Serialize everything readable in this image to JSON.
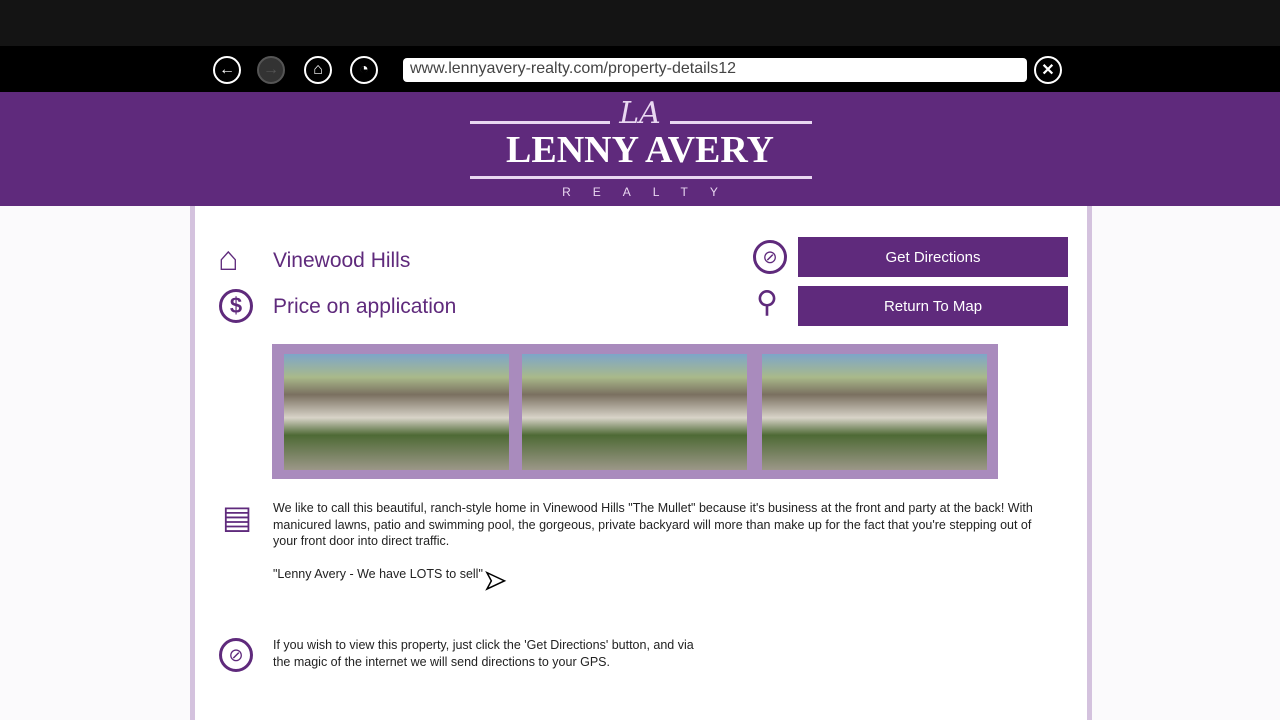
{
  "browser": {
    "url": "www.lennyavery-realty.com/property-details12",
    "icons": [
      "back-icon",
      "forward-icon",
      "home-icon",
      "history-icon",
      "close-icon"
    ]
  },
  "logo": {
    "monogram": "LA",
    "name": "LENNY AVERY",
    "sub": "REALTY"
  },
  "property": {
    "location": "Vinewood Hills",
    "price": "Price on application"
  },
  "buttons": {
    "directions": "Get Directions",
    "return": "Return To Map"
  },
  "description": {
    "body": "We like to call this beautiful, ranch-style home in Vinewood Hills \"The Mullet\" because it's business at the front and party at the back! With manicured lawns, patio and swimming pool, the gorgeous, private backyard will more than make up for the fact that you're stepping out of your front door into direct traffic.",
    "quote": "\"Lenny Avery - We have LOTS to sell\""
  },
  "directions_note": "If you wish to view this property, just click the 'Get Directions' button, and via the magic of the internet we will send directions to your GPS.",
  "colors": {
    "brand": "#5f2a7c",
    "gallery_frame": "#a98bbd"
  }
}
